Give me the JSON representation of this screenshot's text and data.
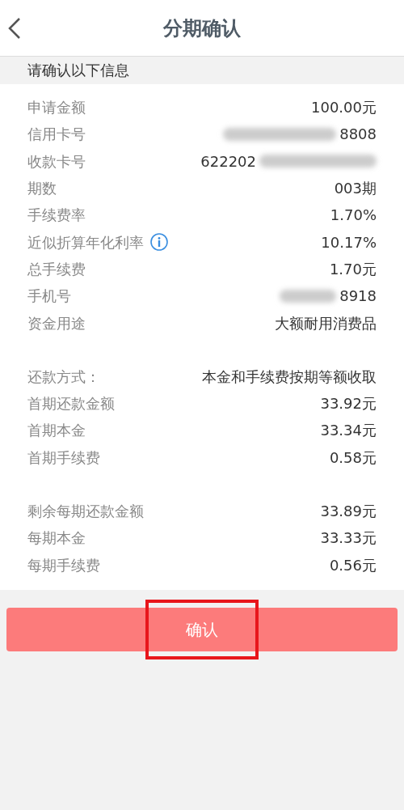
{
  "header": {
    "title": "分期确认"
  },
  "section_title": "请确认以下信息",
  "groups": [
    {
      "rows": [
        {
          "kind": "plain",
          "label": "申请金额",
          "value": "100.00元"
        },
        {
          "kind": "maskedhead",
          "label": "信用卡号",
          "value": "8808"
        },
        {
          "kind": "maskedtail",
          "label": "收款卡号",
          "value": "622202"
        },
        {
          "kind": "plain",
          "label": "期数",
          "value": "003期"
        },
        {
          "kind": "plain",
          "label": "手续费率",
          "value": "1.70%"
        },
        {
          "kind": "info",
          "label": "近似折算年化利率",
          "value": "10.17%"
        },
        {
          "kind": "plain",
          "label": "总手续费",
          "value": "1.70元"
        },
        {
          "kind": "maskedhead",
          "label": "手机号",
          "value": "8918"
        },
        {
          "kind": "plain",
          "label": "资金用途",
          "value": "大额耐用消费品"
        }
      ]
    },
    {
      "rows": [
        {
          "kind": "plain",
          "label": "还款方式：",
          "value": "本金和手续费按期等额收取"
        },
        {
          "kind": "plain",
          "label": "首期还款金额",
          "value": "33.92元"
        },
        {
          "kind": "plain",
          "label": "首期本金",
          "value": "33.34元"
        },
        {
          "kind": "plain",
          "label": "首期手续费",
          "value": "0.58元"
        }
      ]
    },
    {
      "rows": [
        {
          "kind": "plain",
          "label": "剩余每期还款金额",
          "value": "33.89元"
        },
        {
          "kind": "plain",
          "label": "每期本金",
          "value": "33.33元"
        },
        {
          "kind": "plain",
          "label": "每期手续费",
          "value": "0.56元"
        }
      ]
    }
  ],
  "confirm_button": {
    "label": "确认",
    "highlighted": true
  }
}
